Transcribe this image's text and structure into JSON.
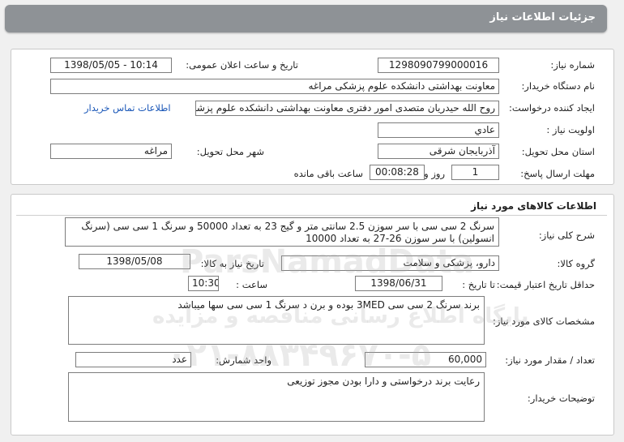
{
  "header": {
    "title": "جزئیات اطلاعات نیاز"
  },
  "info": {
    "need_number_label": "شماره نیاز:",
    "need_number": "1298090799000016",
    "announce_label": "تاریخ و ساعت اعلان عمومی:",
    "announce_value": "1398/05/05 - 10:14",
    "buyer_label": "نام دستگاه خریدار:",
    "buyer_value": "معاونت بهداشتی دانشکده علوم پزشکی مراغه",
    "creator_label": "ایجاد کننده درخواست:",
    "creator_value": "روح الله حیدریان متصدی امور دفتری معاونت بهداشتی دانشکده علوم پزشکی مراغه",
    "contact_link": "اطلاعات تماس خریدار",
    "priority_label": "اولویت نیاز :",
    "priority_value": "عادي",
    "province_label": "استان محل تحویل:",
    "province_value": "آذربایجان شرقی",
    "city_label": "شهر محل تحویل:",
    "city_value": "مراغه",
    "deadline_label": "مهلت ارسال پاسخ:",
    "deadline_days": "1",
    "days_word": "روز و",
    "deadline_time": "00:08:28",
    "remaining_word": "ساعت باقی مانده"
  },
  "goods": {
    "section_title": "اطلاعات کالاهای مورد نیاز",
    "summary_label": "شرح کلی نیاز:",
    "summary_value": "سرنگ 2 سی سی با سر سوزن 2.5 سانتی متر و گیج 23 به تعداد 50000 و سرنگ 1 سی سی (سرنگ انسولین) با سر سوزن 26-27 به تعداد 10000",
    "group_label": "گروه کالا:",
    "group_value": "دارو، پزشکی و سلامت",
    "need_date_label": "تاریخ نیاز به کالا:",
    "need_date_value": "1398/05/08",
    "validity_label": "حداقل تاریخ اعتبار قیمت:",
    "until_date_label": "تا تاریخ :",
    "until_date_value": "1398/06/31",
    "time_label": "ساعت :",
    "time_value": "10:30",
    "specs_label": "مشخصات کالای مورد نیاز:",
    "specs_value": "برند سرنگ 2 سی سی 3MED بوده و برن د سرنگ 1 سی سی سها میباشد",
    "qty_label": "تعداد / مقدار مورد نیاز:",
    "qty_value": "60,000",
    "unit_label": "واحد شمارش:",
    "unit_value": "عدد",
    "notes_label": "توضیحات خریدار:",
    "notes_value": "رعایت برند درخواستی و دارا بودن مجوز توزیعی"
  },
  "watermark": {
    "brand": "ParsNamadData",
    "line1": "پایگاه اطلاع رسانی مناقصه و مزایده",
    "phone": "۰۲۱-۸۸۳۴۹۶۷۰-۵"
  }
}
